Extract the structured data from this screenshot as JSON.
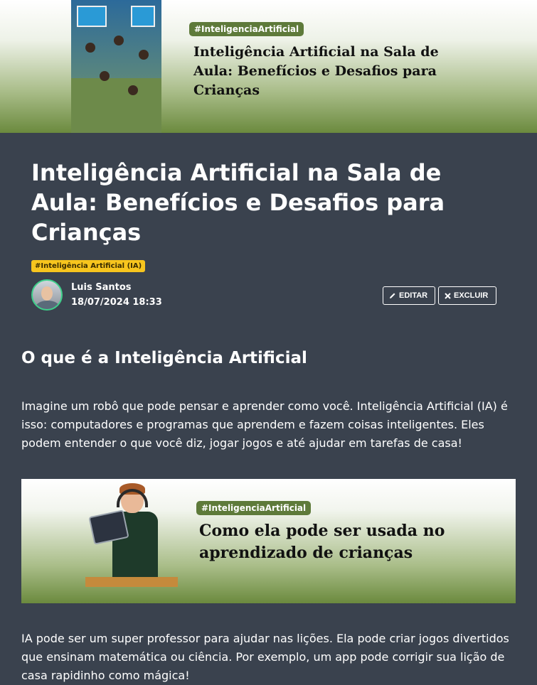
{
  "hero": {
    "tag": "#InteligenciaArtificial",
    "title": "Inteligência Artificial na Sala de Aula: Benefícios e Desafios para Crianças"
  },
  "post": {
    "title": "Inteligência Artificial na Sala de Aula: Benefícios e Desafios para Crianças",
    "category": "#Inteligência Artificial (IA)",
    "author": "Luis Santos",
    "date": "18/07/2024 18:33",
    "edit_label": "EDITAR",
    "delete_label": "EXCLUIR"
  },
  "content": {
    "section_title": "O que é a Inteligência Artificial",
    "paragraph1": "Imagine um robô que pode pensar e aprender como você. Inteligência Artificial (IA) é isso: computadores e programas que aprendem e fazem coisas inteligentes. Eles podem entender o que você diz, jogar jogos e até ajudar em tarefas de casa!",
    "banner_tag": "#InteligenciaArtificial",
    "banner_title": "Como ela pode ser usada no aprendizado de crianças",
    "paragraph2": "IA pode ser um super professor para ajudar nas lições. Ela pode criar jogos divertidos que ensinam matemática ou ciência. Por exemplo, um app pode corrigir sua lição de casa rapidinho como mágica!"
  },
  "colors": {
    "background": "#3a424e",
    "badge": "#f7c51e",
    "tag": "#5e7a3a",
    "avatar_border": "#3dcf8a"
  },
  "icons": [
    "pencil-icon",
    "close-icon"
  ]
}
